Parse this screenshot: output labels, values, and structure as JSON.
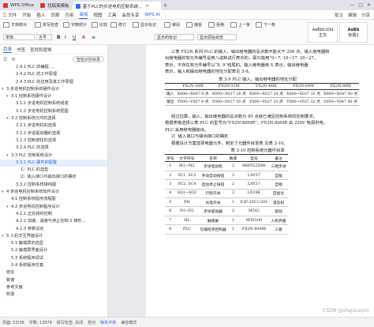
{
  "titlebar": {
    "tabs": [
      {
        "label": "WPS Office",
        "color": "#d93a2f"
      },
      {
        "label": "找稿夷模板",
        "color": "#d93a2f"
      },
      {
        "label": "基于PLC的步进电机控制系统...",
        "color": "#2f6ee6"
      }
    ],
    "plus": "+"
  },
  "menubar": {
    "file": "三 文件",
    "items": [
      "开始",
      "插入",
      "页面",
      "引用",
      "审阅",
      "视图",
      "工具",
      "会员专享"
    ],
    "active": "审阅",
    "ai": "WPS AI",
    "right": [
      "批注",
      "编辑",
      "分享"
    ]
  },
  "ribbon": {
    "row1": [
      "文档校对",
      "拼写检查",
      "字数统计",
      "比较",
      "修订",
      "显示标记",
      "审阅",
      "接受",
      "拒绝",
      "上一条",
      "下一条"
    ],
    "font_name": "宋体",
    "font_size": "五号",
    "style1": "AaBbCcDd",
    "style1_label": "正文",
    "style2": "AaBb",
    "style2_label": "标题1",
    "row2": [
      "显示的标记",
      "显示原始状态"
    ]
  },
  "nav": {
    "tabs": [
      "目录",
      "书签",
      "查找和替换"
    ],
    "smart_label": "智能识别目录",
    "items": [
      {
        "label": "2.4.1 PLC 的编程 ...",
        "level": 3,
        "caret": ""
      },
      {
        "label": "2.4.2 PLC 的工作原理",
        "level": 3,
        "caret": ""
      },
      {
        "label": "2.4.3 PLC 的应用及其工作原理",
        "level": 3,
        "caret": ""
      },
      {
        "label": "3 步进电机控制系统硬件设计",
        "level": 1,
        "caret": "▾"
      },
      {
        "label": "3.1 控制系统硬件设计",
        "level": 2,
        "caret": "▾"
      },
      {
        "label": "3.1.1 步进电机控制系统组成",
        "level": 3,
        "caret": ""
      },
      {
        "label": "3.1.2 步进电机控制系统框图",
        "level": 3,
        "caret": ""
      },
      {
        "label": "3.2 控制系统元件的选择",
        "level": 2,
        "caret": "▾"
      },
      {
        "label": "3.2.1 步进电机的选择",
        "level": 3,
        "caret": ""
      },
      {
        "label": "3.2.2 步进驱动器的选择",
        "level": 3,
        "caret": ""
      },
      {
        "label": "3.2.3 控制按钮的选择",
        "level": 3,
        "caret": ""
      },
      {
        "label": "3.2.4 PLC 的选择",
        "level": 3,
        "caret": ""
      },
      {
        "label": "3.3 PLC 控制系统设计",
        "level": 2,
        "caret": "▾"
      },
      {
        "label": "3.3.1 PLC 硬件的配置",
        "level": 3,
        "caret": ""
      },
      {
        "label": "1）PLC 的选型",
        "level": 4,
        "caret": ""
      },
      {
        "label": "2）输入接口与输出接口的确定",
        "level": 4,
        "caret": ""
      },
      {
        "label": "3.3.2 控制系统接线图",
        "level": 3,
        "caret": ""
      },
      {
        "label": "4 步进电机控制系统软件设计",
        "level": 1,
        "caret": "▾"
      },
      {
        "label": "4.1 控制系统程序流程图",
        "level": 2,
        "caret": ""
      },
      {
        "label": "4.2 步进电机控制程序设计",
        "level": 2,
        "caret": "▾"
      },
      {
        "label": "4.2.1 正反转的控制",
        "level": 3,
        "caret": ""
      },
      {
        "label": "4.2.2 加速、减速与停止控制 2 梯形...",
        "level": 3,
        "caret": ""
      },
      {
        "label": "4.2.3 参数设定",
        "level": 3,
        "caret": ""
      },
      {
        "label": "5 人机交互界面设计",
        "level": 1,
        "caret": "▾"
      },
      {
        "label": "5.1 触摸屏的选型",
        "level": 2,
        "caret": ""
      },
      {
        "label": "5.2 触摸屏界面设计",
        "level": 2,
        "caret": ""
      },
      {
        "label": "5.3 系统程序调试",
        "level": 2,
        "caret": ""
      },
      {
        "label": "5.4 系统程序仿真",
        "level": 2,
        "caret": ""
      },
      {
        "label": "结论",
        "level": 1,
        "caret": ""
      },
      {
        "label": "致谢",
        "level": 1,
        "caret": ""
      },
      {
        "label": "参考文献",
        "level": 1,
        "caret": ""
      },
      {
        "label": "附录",
        "level": 1,
        "caret": ""
      }
    ],
    "selected_index": 13
  },
  "document": {
    "para1": [
      "三菱 FX2N 系列 PLC 的输入、输出继电器的总点数不能大于 256 点，输入继电器和",
      "出继电器的软元件编号是用八进制进行表示的，即只能用“0~7, 10~17, 20~27，",
      "表示，不存在软元件编号以“8, 9”结尾的。输入继电器用 X 表示，输出继电器",
      "表示。输入和输出继电器的地址分配表见 3-9。"
    ],
    "table1": {
      "caption": "表 3-9 PLC 输入、输出继电器的地址分配",
      "headers": [
        "",
        "FX2N-16M",
        "FX2N-32M",
        "FX2N-48M",
        "FX2N-64M",
        "FX2N-80M"
      ],
      "rows": [
        [
          "输入",
          "X000~X007 8 点",
          "X000~X017 16 点",
          "X000~X027 24 点",
          "X000~X037 32 点",
          "X000~X047 40 点"
        ],
        [
          "输出",
          "Y000~Y007 8 点",
          "Y000~Y017 16 点",
          "Y000~Y027 24 点",
          "Y000~Y037 32 点",
          "Y000~Y047 40 点"
        ]
      ]
    },
    "para2": [
      "经过估算，输入、输出继电器的总点数为 80 点就已满足控制系统的控制要求，",
      "根据表格选择三菱 PLC 的型号为“FX2N-80MR”，FX2N-80MR 由 220V 电源供电，",
      "PLC 采用继电器输出。",
      "2）输入接口与输出接口的确定",
      "根据设计方案选择电器元件，制定了元器件目录表 见表 3-10。"
    ],
    "table2": {
      "caption": "表 3-10 控制系统元器件目录",
      "headers": [
        "序号",
        "文字符号",
        "名称",
        "数量",
        "型号",
        "备注"
      ],
      "rows": [
        [
          "1",
          "M1~M2",
          "步进电动机",
          "2",
          "86BYG250H",
          "三相步进"
        ],
        [
          "2",
          "SC1, SC3",
          "手动自动按钮",
          "2",
          "LAY37",
          "自锁"
        ],
        [
          "3",
          "SC2, SC4",
          "启动停止按钮",
          "2",
          "LAY37",
          "自锁"
        ],
        [
          "4",
          "SQ1~SQ3",
          "行程开关",
          "3",
          "LX19K",
          "自复位"
        ],
        [
          "5",
          "PH",
          "光电开关",
          "1",
          "E3F-20C1/20L",
          "漫反射"
        ],
        [
          "6",
          "D1~D2",
          "步进驱动器",
          "2",
          "M542",
          "驱动"
        ],
        [
          "7",
          "HL",
          "触摸屏",
          "1",
          "MT6100",
          "人机界面"
        ],
        [
          "8",
          "PLC",
          "可编程序控制器",
          "1",
          "FX2N-80MR",
          "三菱"
        ]
      ]
    },
    "watermark": "CSDN @shejizuopin"
  },
  "statusbar": {
    "items": [
      "页面: 23/38",
      "字数: 13979",
      "拼写检查: 关闭",
      "校对",
      "缺失字体",
      "兼容模式"
    ],
    "highlight_index": 4
  }
}
